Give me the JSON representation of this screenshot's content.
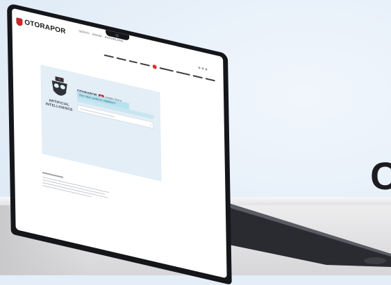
{
  "site": {
    "logo_text": "OTORAPOR",
    "tagline": "SERVİS · BAKIM · RAPORLAMA"
  },
  "panel": {
    "ai_label": "ARTIFICIAL INTELLIGENCE",
    "brand_name": "OTORAPOR",
    "brand_badge": "AI",
    "brand_suffix": "YAPAY ZEKA",
    "prompt_text": "Size nasıl yardımcı olabilirim?"
  },
  "hero": {
    "partial_text": "C"
  },
  "colors": {
    "brand_red": "#c42b2b",
    "panel_bg": "#e3eef7",
    "prompt_bg": "#b6e1ee",
    "page_bg": "#e4eef8",
    "device_dark": "#15161a"
  },
  "icons": {
    "logo": "otorapor-shield-logo",
    "assistant": "robot-mask-icon",
    "submit": "arrow-right-icon"
  }
}
